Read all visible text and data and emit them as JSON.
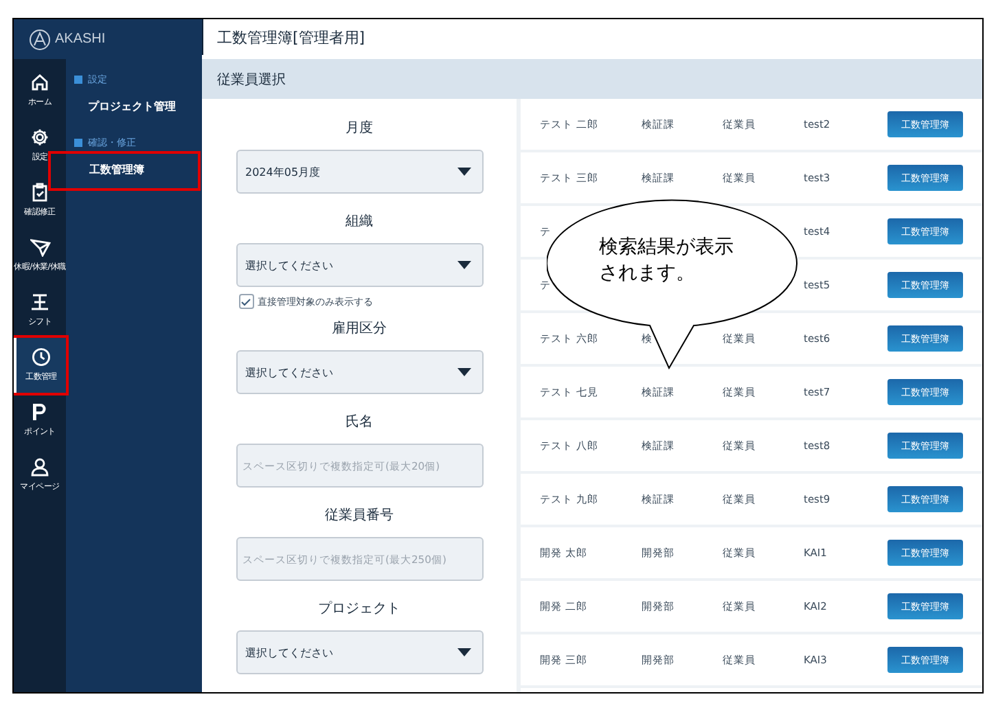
{
  "brand": "AKASHI",
  "rail": [
    {
      "label": "ホーム",
      "selected": false,
      "highlighted": false
    },
    {
      "label": "設定",
      "selected": false,
      "highlighted": false
    },
    {
      "label": "確認修正",
      "selected": false,
      "highlighted": false
    },
    {
      "label": "休暇/休業/休職",
      "selected": false,
      "highlighted": false
    },
    {
      "label": "シフト",
      "selected": false,
      "highlighted": false
    },
    {
      "label": "工数管理",
      "selected": true,
      "highlighted": true
    },
    {
      "label": "ポイント",
      "selected": false,
      "highlighted": false
    },
    {
      "label": "マイページ",
      "selected": false,
      "highlighted": false
    }
  ],
  "submenu": [
    {
      "heading": "設定",
      "items": [
        {
          "label": "プロジェクト管理",
          "selected": false,
          "highlighted": false
        }
      ]
    },
    {
      "heading": "確認・修正",
      "items": [
        {
          "label": "工数管理簿",
          "selected": true,
          "highlighted": true
        }
      ]
    }
  ],
  "page_title": "工数管理簿[管理者用]",
  "section_title": "従業員選択",
  "form": [
    {
      "kind": "select",
      "label": "月度",
      "value": "2024年05月度"
    },
    {
      "kind": "select",
      "label": "組織",
      "value": "選択してください"
    },
    {
      "kind": "checkbox",
      "label": "直接管理対象のみ表示する",
      "checked": true
    },
    {
      "kind": "select",
      "label": "雇用区分",
      "value": "選択してください"
    },
    {
      "kind": "text",
      "label": "氏名",
      "placeholder": "スペース区切りで複数指定可(最大20個)"
    },
    {
      "kind": "text",
      "label": "従業員番号",
      "placeholder": "スペース区切りで複数指定可(最大250個)"
    },
    {
      "kind": "select",
      "label": "プロジェクト",
      "value": "選択してください"
    }
  ],
  "results": [
    {
      "name": "テスト 二郎",
      "department": "検証課",
      "role": "従業員",
      "id": "test2",
      "button": "工数管理簿"
    },
    {
      "name": "テスト 三郎",
      "department": "検証課",
      "role": "従業員",
      "id": "test3",
      "button": "工数管理簿"
    },
    {
      "name": "テ",
      "id": "test4",
      "button": "工数管理簿"
    },
    {
      "name": "テ",
      "id": "test5",
      "button": "工数管理簿"
    },
    {
      "name": "テスト 六郎",
      "department": "検",
      "role": "従業員",
      "id": "test6",
      "button": "工数管理簿"
    },
    {
      "name": "テスト 七見",
      "department": "検証課",
      "role": "従業員",
      "id": "test7",
      "button": "工数管理簿"
    },
    {
      "name": "テスト 八郎",
      "department": "検証課",
      "role": "従業員",
      "id": "test8",
      "button": "工数管理簿"
    },
    {
      "name": "テスト 九郎",
      "department": "検証課",
      "role": "従業員",
      "id": "test9",
      "button": "工数管理簿"
    },
    {
      "name": "開発 太郎",
      "department": "開発部",
      "role": "従業員",
      "id": "KAI1",
      "button": "工数管理簿"
    },
    {
      "name": "開発 二郎",
      "department": "開発部",
      "role": "従業員",
      "id": "KAI2",
      "button": "工数管理簿"
    },
    {
      "name": "開発 三郎",
      "department": "開発部",
      "role": "従業員",
      "id": "KAI3",
      "button": "工数管理簿"
    }
  ],
  "callout": {
    "text": "検索結果が表示されます。"
  }
}
